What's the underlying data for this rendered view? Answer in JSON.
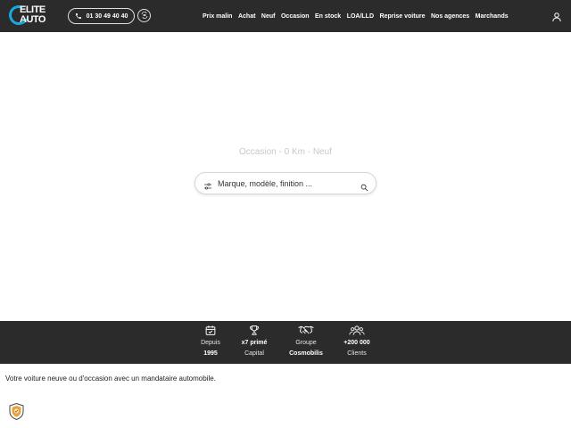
{
  "header": {
    "logo": {
      "line1": "ELITE",
      "line2": "AUTO"
    },
    "phone": "01 30 49 40 40",
    "nav": [
      "Prix malin",
      "Achat",
      "Neuf",
      "Occasion",
      "En stock",
      "LOA/LLD",
      "Reprise voiture",
      "Nos agences",
      "Marchands"
    ]
  },
  "hero": {
    "subtitle": "Occasion - 0 Km - Neuf",
    "search_placeholder": "Marque, modèle, finition ..."
  },
  "stats": [
    {
      "icon": "calendar-check-icon",
      "line1": "Depuis",
      "line2": "1995",
      "bold": "line2"
    },
    {
      "icon": "trophy-icon",
      "line1": "x7 primé",
      "line2": "Capital",
      "bold": "line1"
    },
    {
      "icon": "handshake-icon",
      "line1": "Groupe",
      "line2": "Cosmobilis",
      "bold": "line2"
    },
    {
      "icon": "users-group-icon",
      "line1": "+200 000",
      "line2": "Clients",
      "bold": "line1"
    }
  ],
  "tagline": "Votre voiture neuve ou d'occasion avec un mandataire automobile.",
  "colors": {
    "header_bg": "#2b2b2b",
    "accent": "#18a9e0",
    "badge": "#e8a33a"
  }
}
